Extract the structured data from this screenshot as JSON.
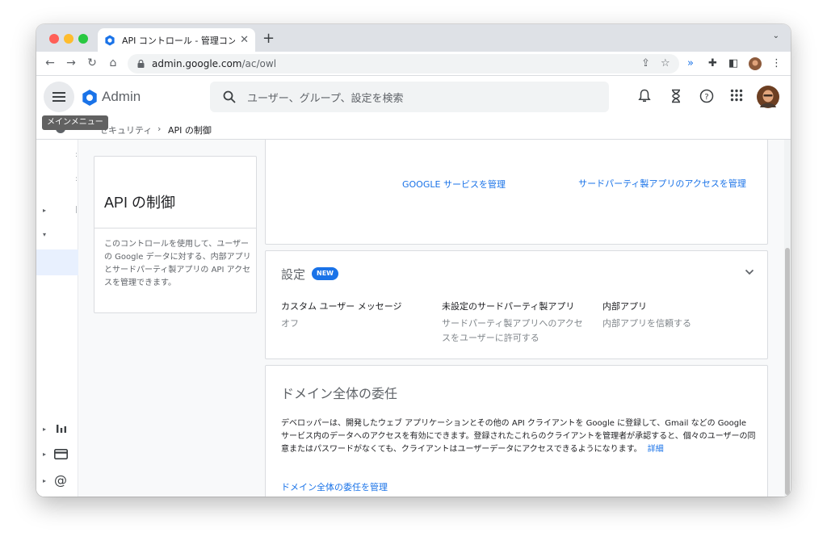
{
  "browser": {
    "tab_title": "API コントロール - 管理コンソール",
    "tab_close": "✕",
    "new_tab": "+",
    "tab_menu": "⌄",
    "url_host": "admin.google.com",
    "url_path": "/ac/owl"
  },
  "header": {
    "app_title": "Admin",
    "search_placeholder": "ユーザー、グループ、設定を検索",
    "menu_tooltip": "メインメニュー"
  },
  "breadcrumb": {
    "parent": "セキュリティ",
    "separator": "›",
    "current": "API の制御"
  },
  "description": {
    "title": "API の制御",
    "text": "このコントロールを使用して、ユーザーの Google データに対する、内部アプリとサードパーティ製アプリの API アクセスを管理できます。"
  },
  "apps_card": {
    "link_google": "GOOGLE サービスを管理",
    "link_third_party": "サードパーティ製アプリのアクセスを管理"
  },
  "settings_card": {
    "title": "設定",
    "badge": "NEW",
    "columns": [
      {
        "heading": "カスタム ユーザー メッセージ",
        "value": "オフ"
      },
      {
        "heading": "未設定のサードパーティ製アプリ",
        "value": "サードパーティ製アプリへのアクセスをユーザーに許可する"
      },
      {
        "heading": "内部アプリ",
        "value": "内部アプリを信頼する"
      }
    ]
  },
  "delegation_card": {
    "title": "ドメイン全体の委任",
    "body": "デベロッパーは、開発したウェブ アプリケーションとその他の API クライアントを Google に登録して、Gmail などの Google サービス内のデータへのアクセスを有効にできます。登録されたこれらのクライアントを管理者が承認すると、個々のユーザーの同意またはパスワードがなくても、クライアントはユーザーデータにアクセスできるようになります。",
    "more_link": "詳細",
    "manage_link": "ドメイン全体の委任を管理"
  },
  "colors": {
    "accent": "#1a73e8",
    "badge": "#1a73e8"
  }
}
